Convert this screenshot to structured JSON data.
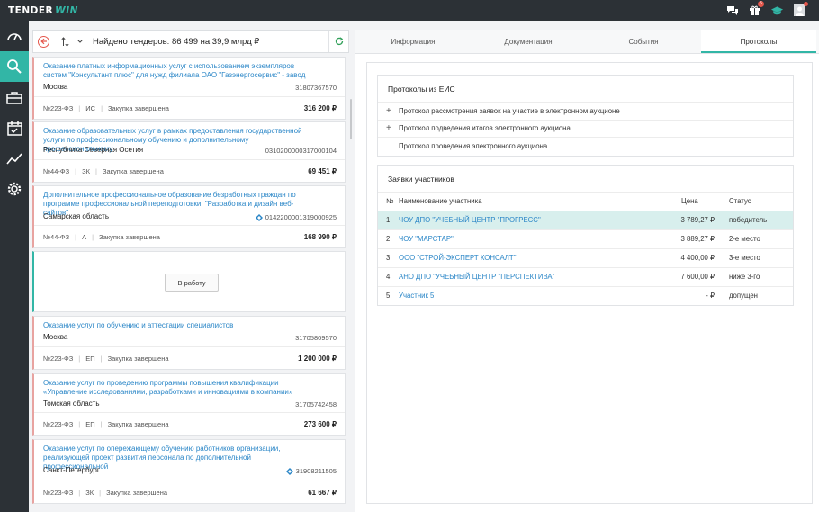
{
  "app": {
    "logo_main": "TENDER",
    "logo_accent": "WIN"
  },
  "topbar": {
    "icons": [
      "chat-icon",
      "gift-icon",
      "graduation-cap-icon",
      "user-avatar-icon"
    ],
    "gift_badge": "5",
    "colors": {
      "bar": "#2c3136",
      "accent": "#32b6a6",
      "badge": "#e5574c"
    }
  },
  "sidebar": {
    "items": [
      {
        "icon": "speedometer-icon",
        "active": false
      },
      {
        "icon": "search-icon",
        "active": true
      },
      {
        "icon": "briefcase-icon",
        "active": false
      },
      {
        "icon": "calendar-check-icon",
        "active": false
      },
      {
        "icon": "chart-line-icon",
        "active": false
      },
      {
        "icon": "gear-icon",
        "active": false
      }
    ]
  },
  "list": {
    "found_text": "Найдено тендеров: 86 499 на 39,9 млрд ₽",
    "cards": [
      {
        "title": "Оказание платных информационных услуг с использованием экземпляров систем \"Консультант плюс\" для нужд филиала ОАО \"Газэнергосервис\" - завод",
        "region": "Москва",
        "number": "31807367570",
        "law": "№223-ФЗ",
        "type": "ИС",
        "status": "Закупка завершена",
        "price": "316 200 ₽"
      },
      {
        "title": "Оказание образовательных услуг в рамках предоставления государственной услуги по профессиональному обучению и дополнительному профессиональному",
        "region": "Республика Северная Осетия",
        "number": "0310200000317000104",
        "law": "№44-ФЗ",
        "type": "ЗК",
        "status": "Закупка завершена",
        "price": "69 451 ₽"
      },
      {
        "title": "Дополнительное профессиональное образование безработных граждан по программе профессиональной переподготовки: \"Разработка и дизайн веб-сайтов\"",
        "region": "Самарская область",
        "number": "0142200001319000925",
        "law": "№44-ФЗ",
        "type": "А",
        "status": "Закупка завершена",
        "price": "168 990 ₽"
      },
      {
        "title": "Оказание услуг по обучению и аттестации специалистов",
        "region": "Москва",
        "number": "31705809570",
        "law": "№223-ФЗ",
        "type": "ЕП",
        "status": "Закупка завершена",
        "price": "1 200 000 ₽"
      },
      {
        "title": "Оказание услуг по проведению программы повышения квалификации «Управление исследованиями, разработками и инновациями в компании»",
        "region": "Томская область",
        "number": "31705742458",
        "law": "№223-ФЗ",
        "type": "ЕП",
        "status": "Закупка завершена",
        "price": "273 600 ₽"
      },
      {
        "title": "Оказание услуг по опережающему обучению работников организации, реализующей проект развития персонала по дополнительной профессиональной",
        "region": "Санкт-Петербург",
        "number": "31908211505",
        "law": "№223-ФЗ",
        "type": "ЗК",
        "status": "Закупка завершена",
        "price": "61 667 ₽"
      }
    ],
    "work_button": "В работу"
  },
  "tabs": [
    "Информация",
    "Документация",
    "События",
    "Протоколы"
  ],
  "active_tab": "Протоколы",
  "protocols": {
    "heading": "Протоколы из ЕИС",
    "items": [
      {
        "label": "Протокол рассмотрения заявок на участие в электронном аукционе",
        "expandable": true
      },
      {
        "label": "Протокол подведения итогов электронного аукциона",
        "expandable": true
      },
      {
        "label": "Протокол проведения электронного аукциона",
        "expandable": false
      }
    ]
  },
  "bids": {
    "heading": "Заявки участников",
    "columns": [
      "№",
      "Наименование участника",
      "Цена",
      "Статус"
    ],
    "rows": [
      {
        "n": "1",
        "name": "ЧОУ ДПО \"УЧЕБНЫЙ ЦЕНТР \"ПРОГРЕСС\"",
        "price": "3 789,27 ₽",
        "status": "победитель"
      },
      {
        "n": "2",
        "name": "ЧОУ \"МАРСТАР\"",
        "price": "3 889,27 ₽",
        "status": "2-е место"
      },
      {
        "n": "3",
        "name": "ООО \"СТРОЙ-ЭКСПЕРТ КОНСАЛТ\"",
        "price": "4 400,00 ₽",
        "status": "3-е место"
      },
      {
        "n": "4",
        "name": "АНО ДПО \"УЧЕБНЫЙ ЦЕНТР \"ПЕРСПЕКТИВА\"",
        "price": "7 600,00 ₽",
        "status": "ниже 3-го"
      },
      {
        "n": "5",
        "name": "Участник 5",
        "price": "- ₽",
        "status": "допущен"
      }
    ]
  }
}
